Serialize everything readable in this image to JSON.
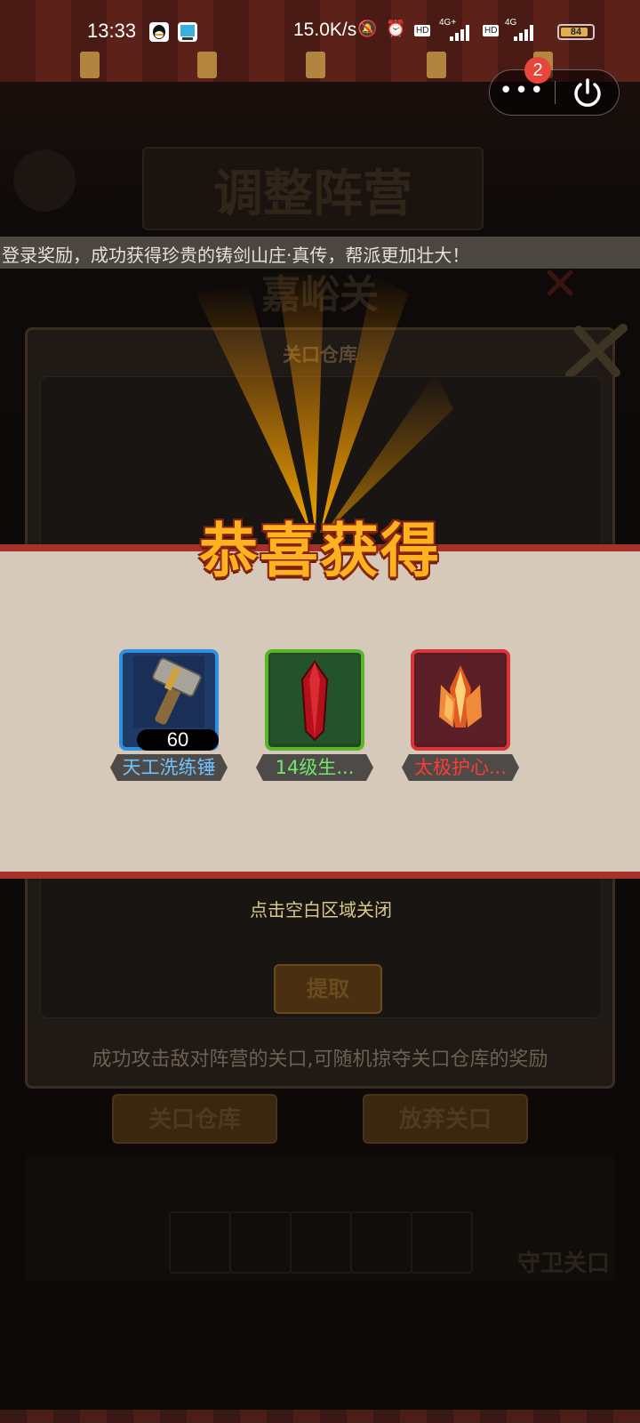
{
  "status_bar": {
    "time": "13:33",
    "net_speed": "15.0K/s",
    "hd_label": "HD",
    "net1": "4G+",
    "net2": "4G",
    "battery": "84"
  },
  "capsule": {
    "badge": "2",
    "more_icon": "more-dots-icon",
    "power_icon": "power-icon"
  },
  "background": {
    "title_text": "调整阵营",
    "pass_name": "嘉峪关",
    "notice": "登录奖励，成功获得珍贵的铸剑山庄·真传，帮派更加壮大！",
    "warehouse_title": "关口仓库",
    "fetch_button": "提取",
    "description": "成功攻击敌对阵营的关口,可随机掠夺关口仓库的奖励",
    "warehouse_button": "关口仓库",
    "abandon_button": "放弃关口",
    "guard_button": "守卫关口"
  },
  "reward": {
    "title": "恭喜获得",
    "close_hint": "点击空白区域关闭",
    "items": [
      {
        "name": "天工洗练锤",
        "count": "60",
        "rarity_color": "#2f8fe0",
        "label_color": "#6cc3ff",
        "icon": "hammer-icon"
      },
      {
        "name": "14级生...",
        "count": "",
        "rarity_color": "#59b52a",
        "label_color": "#6fe86a",
        "icon": "red-crystal-icon"
      },
      {
        "name": "太极护心...",
        "count": "",
        "rarity_color": "#d6353a",
        "label_color": "#ff3a36",
        "icon": "fire-crystal-icon"
      }
    ]
  }
}
